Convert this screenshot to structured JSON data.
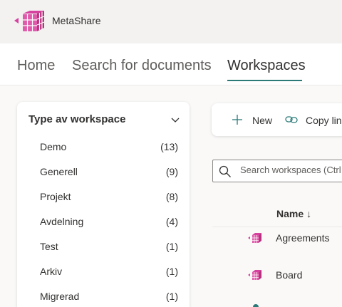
{
  "app": {
    "name": "MetaShare",
    "logo_icon": "metashare-cube-logo",
    "brand_color": "#d6409f",
    "accent_color": "#2b7a78"
  },
  "nav": {
    "tabs": [
      {
        "label": "Home"
      },
      {
        "label": "Search for documents"
      },
      {
        "label": "Workspaces",
        "active": true
      }
    ]
  },
  "filter": {
    "title": "Type av workspace",
    "items": [
      {
        "label": "Demo",
        "count": "(13)"
      },
      {
        "label": "Generell",
        "count": "(9)"
      },
      {
        "label": "Projekt",
        "count": "(8)"
      },
      {
        "label": "Avdelning",
        "count": "(4)"
      },
      {
        "label": "Test",
        "count": "(1)"
      },
      {
        "label": "Arkiv",
        "count": "(1)"
      },
      {
        "label": "Migrerad",
        "count": "(1)"
      }
    ]
  },
  "commands": {
    "new_label": "New",
    "copy_label": "Copy lin"
  },
  "search": {
    "placeholder": "Search workspaces (Ctrl"
  },
  "table": {
    "name_header": "Name",
    "sort_icon": "sort-down-arrow-icon",
    "rows": [
      {
        "name": "Agreements"
      },
      {
        "name": "Board"
      }
    ]
  }
}
